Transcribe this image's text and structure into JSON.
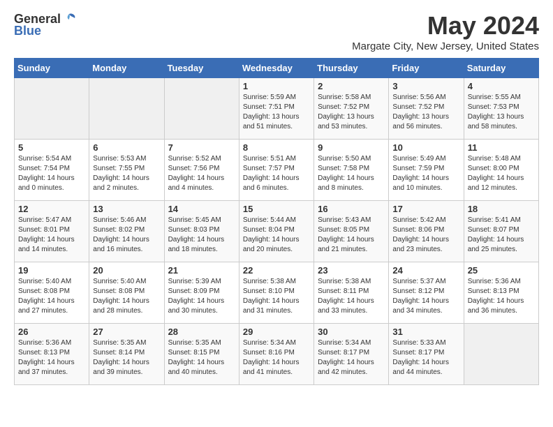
{
  "logo": {
    "general": "General",
    "blue": "Blue"
  },
  "title": "May 2024",
  "location": "Margate City, New Jersey, United States",
  "days_of_week": [
    "Sunday",
    "Monday",
    "Tuesday",
    "Wednesday",
    "Thursday",
    "Friday",
    "Saturday"
  ],
  "weeks": [
    [
      {
        "day": "",
        "info": ""
      },
      {
        "day": "",
        "info": ""
      },
      {
        "day": "",
        "info": ""
      },
      {
        "day": "1",
        "info": "Sunrise: 5:59 AM\nSunset: 7:51 PM\nDaylight: 13 hours\nand 51 minutes."
      },
      {
        "day": "2",
        "info": "Sunrise: 5:58 AM\nSunset: 7:52 PM\nDaylight: 13 hours\nand 53 minutes."
      },
      {
        "day": "3",
        "info": "Sunrise: 5:56 AM\nSunset: 7:52 PM\nDaylight: 13 hours\nand 56 minutes."
      },
      {
        "day": "4",
        "info": "Sunrise: 5:55 AM\nSunset: 7:53 PM\nDaylight: 13 hours\nand 58 minutes."
      }
    ],
    [
      {
        "day": "5",
        "info": "Sunrise: 5:54 AM\nSunset: 7:54 PM\nDaylight: 14 hours\nand 0 minutes."
      },
      {
        "day": "6",
        "info": "Sunrise: 5:53 AM\nSunset: 7:55 PM\nDaylight: 14 hours\nand 2 minutes."
      },
      {
        "day": "7",
        "info": "Sunrise: 5:52 AM\nSunset: 7:56 PM\nDaylight: 14 hours\nand 4 minutes."
      },
      {
        "day": "8",
        "info": "Sunrise: 5:51 AM\nSunset: 7:57 PM\nDaylight: 14 hours\nand 6 minutes."
      },
      {
        "day": "9",
        "info": "Sunrise: 5:50 AM\nSunset: 7:58 PM\nDaylight: 14 hours\nand 8 minutes."
      },
      {
        "day": "10",
        "info": "Sunrise: 5:49 AM\nSunset: 7:59 PM\nDaylight: 14 hours\nand 10 minutes."
      },
      {
        "day": "11",
        "info": "Sunrise: 5:48 AM\nSunset: 8:00 PM\nDaylight: 14 hours\nand 12 minutes."
      }
    ],
    [
      {
        "day": "12",
        "info": "Sunrise: 5:47 AM\nSunset: 8:01 PM\nDaylight: 14 hours\nand 14 minutes."
      },
      {
        "day": "13",
        "info": "Sunrise: 5:46 AM\nSunset: 8:02 PM\nDaylight: 14 hours\nand 16 minutes."
      },
      {
        "day": "14",
        "info": "Sunrise: 5:45 AM\nSunset: 8:03 PM\nDaylight: 14 hours\nand 18 minutes."
      },
      {
        "day": "15",
        "info": "Sunrise: 5:44 AM\nSunset: 8:04 PM\nDaylight: 14 hours\nand 20 minutes."
      },
      {
        "day": "16",
        "info": "Sunrise: 5:43 AM\nSunset: 8:05 PM\nDaylight: 14 hours\nand 21 minutes."
      },
      {
        "day": "17",
        "info": "Sunrise: 5:42 AM\nSunset: 8:06 PM\nDaylight: 14 hours\nand 23 minutes."
      },
      {
        "day": "18",
        "info": "Sunrise: 5:41 AM\nSunset: 8:07 PM\nDaylight: 14 hours\nand 25 minutes."
      }
    ],
    [
      {
        "day": "19",
        "info": "Sunrise: 5:40 AM\nSunset: 8:08 PM\nDaylight: 14 hours\nand 27 minutes."
      },
      {
        "day": "20",
        "info": "Sunrise: 5:40 AM\nSunset: 8:08 PM\nDaylight: 14 hours\nand 28 minutes."
      },
      {
        "day": "21",
        "info": "Sunrise: 5:39 AM\nSunset: 8:09 PM\nDaylight: 14 hours\nand 30 minutes."
      },
      {
        "day": "22",
        "info": "Sunrise: 5:38 AM\nSunset: 8:10 PM\nDaylight: 14 hours\nand 31 minutes."
      },
      {
        "day": "23",
        "info": "Sunrise: 5:38 AM\nSunset: 8:11 PM\nDaylight: 14 hours\nand 33 minutes."
      },
      {
        "day": "24",
        "info": "Sunrise: 5:37 AM\nSunset: 8:12 PM\nDaylight: 14 hours\nand 34 minutes."
      },
      {
        "day": "25",
        "info": "Sunrise: 5:36 AM\nSunset: 8:13 PM\nDaylight: 14 hours\nand 36 minutes."
      }
    ],
    [
      {
        "day": "26",
        "info": "Sunrise: 5:36 AM\nSunset: 8:13 PM\nDaylight: 14 hours\nand 37 minutes."
      },
      {
        "day": "27",
        "info": "Sunrise: 5:35 AM\nSunset: 8:14 PM\nDaylight: 14 hours\nand 39 minutes."
      },
      {
        "day": "28",
        "info": "Sunrise: 5:35 AM\nSunset: 8:15 PM\nDaylight: 14 hours\nand 40 minutes."
      },
      {
        "day": "29",
        "info": "Sunrise: 5:34 AM\nSunset: 8:16 PM\nDaylight: 14 hours\nand 41 minutes."
      },
      {
        "day": "30",
        "info": "Sunrise: 5:34 AM\nSunset: 8:17 PM\nDaylight: 14 hours\nand 42 minutes."
      },
      {
        "day": "31",
        "info": "Sunrise: 5:33 AM\nSunset: 8:17 PM\nDaylight: 14 hours\nand 44 minutes."
      },
      {
        "day": "",
        "info": ""
      }
    ]
  ]
}
